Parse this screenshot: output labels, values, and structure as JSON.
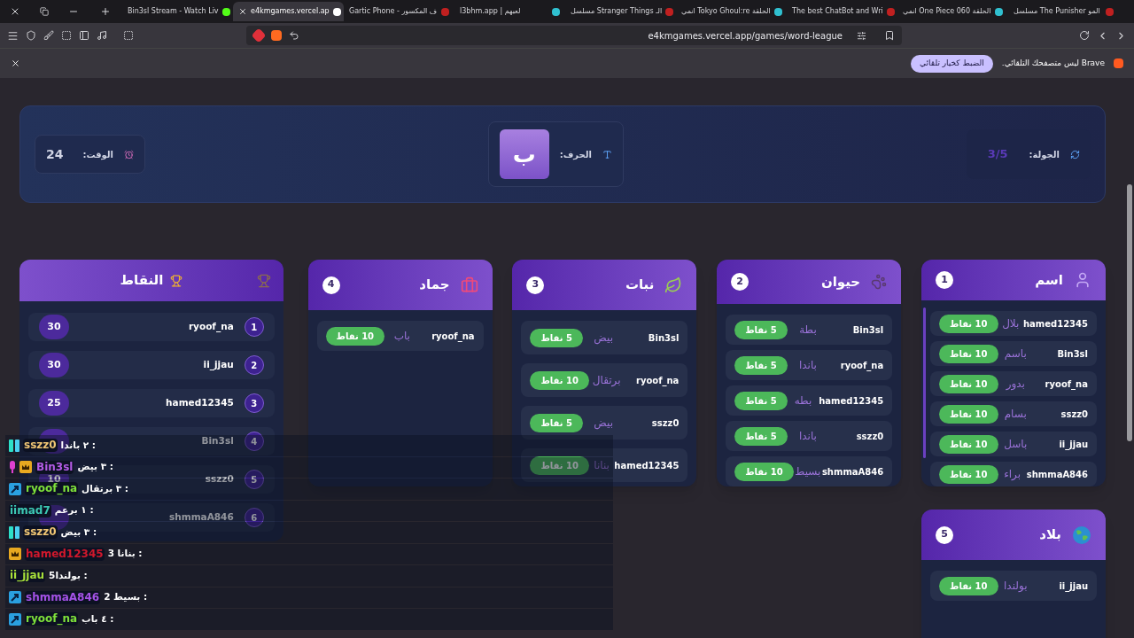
{
  "browser": {
    "tabs": [
      {
        "title": "مسلسل The Punisher المو",
        "selected": false
      },
      {
        "title": "انمي One Piece الحلقة 060",
        "selected": false
      },
      {
        "title": "The best ChatBot and Wri",
        "selected": false
      },
      {
        "title": "انمي Tokyo Ghoul:re الحلقة",
        "selected": false
      },
      {
        "title": "مسلسل Stranger Things الـ",
        "selected": false
      },
      {
        "title": "l3bhm.app | لعبهم",
        "selected": false
      },
      {
        "title": "Gartic Phone - ف المكسور",
        "selected": false
      },
      {
        "title": "e4kmgames.vercel.ap",
        "selected": true
      },
      {
        "title": "Bin3sl Stream - Watch Liv",
        "selected": false
      }
    ],
    "address": "e4kmgames.vercel.app/games/word-league",
    "notice": {
      "text": "Brave ليس متصفحك التلقائي.",
      "button": "الضبط كخيار تلقائي"
    }
  },
  "header": {
    "round": {
      "label": "الجولة:",
      "value": "3/5"
    },
    "letter": {
      "label": "الحرف:",
      "value": "ب"
    },
    "time": {
      "label": "الوقت:",
      "value": "24"
    }
  },
  "categories": [
    {
      "name": "اسم",
      "number": "1",
      "answers": [
        {
          "player": "hamed12345",
          "word": "بلال",
          "points": "10 نقاط"
        },
        {
          "player": "Bin3sl",
          "word": "باسم",
          "points": "10 نقاط"
        },
        {
          "player": "ryoof_na",
          "word": "بدور",
          "points": "10 نقاط"
        },
        {
          "player": "sszz0",
          "word": "بسام",
          "points": "10 نقاط"
        },
        {
          "player": "ii_jjau",
          "word": "باسل",
          "points": "10 نقاط"
        },
        {
          "player": "shmmaA846",
          "word": "براء",
          "points": "10 نقاط"
        }
      ]
    },
    {
      "name": "حيوان",
      "number": "2",
      "answers": [
        {
          "player": "Bin3sl",
          "word": "بطة",
          "points": "5 نقاط"
        },
        {
          "player": "ryoof_na",
          "word": "باندا",
          "points": "5 نقاط"
        },
        {
          "player": "hamed12345",
          "word": "بطه",
          "points": "5 نقاط"
        },
        {
          "player": "sszz0",
          "word": "باندا",
          "points": "5 نقاط"
        },
        {
          "player": "shmmaA846",
          "word": "بسيط",
          "points": "10 نقاط"
        }
      ]
    },
    {
      "name": "نبات",
      "number": "3",
      "answers": [
        {
          "player": "Bin3sl",
          "word": "بيض",
          "points": "5 نقاط"
        },
        {
          "player": "ryoof_na",
          "word": "برتقال",
          "points": "10 نقاط"
        },
        {
          "player": "sszz0",
          "word": "بيض",
          "points": "5 نقاط"
        },
        {
          "player": "hamed12345",
          "word": "بنانا",
          "points": "10 نقاط"
        }
      ]
    },
    {
      "name": "جماد",
      "number": "4",
      "answers": [
        {
          "player": "ryoof_na",
          "word": "باب",
          "points": "10 نقاط"
        }
      ]
    },
    {
      "name": "بلاد",
      "number": "5",
      "answers": [
        {
          "player": "ii_jjau",
          "word": "بولندا",
          "points": "10 نقاط"
        }
      ]
    }
  ],
  "scoreboard": {
    "title": "النقاط",
    "rows": [
      {
        "rank": "1",
        "player": "ryoof_na",
        "score": "30"
      },
      {
        "rank": "2",
        "player": "ii_jjau",
        "score": "30"
      },
      {
        "rank": "3",
        "player": "hamed12345",
        "score": "25"
      },
      {
        "rank": "4",
        "player": "Bin3sl"
      },
      {
        "rank": "5",
        "player": "sszz0",
        "score": "10"
      },
      {
        "rank": "6",
        "player": "shmmaA846"
      }
    ]
  },
  "chat": [
    {
      "user": "sszz0",
      "color": "#f0c674",
      "badges": [
        {
          "kind": "sub"
        }
      ],
      "message": ": ٢ باندا"
    },
    {
      "user": "Bin3sl",
      "color": "#b45ce6",
      "badges": [
        {
          "kind": "mic"
        },
        {
          "kind": "crown"
        }
      ],
      "message": ": ٣ بيض"
    },
    {
      "user": "ryoof_na",
      "color": "#7ee03a",
      "badges": [
        {
          "kind": "arrow"
        }
      ],
      "message": ": ٣ برتقال"
    },
    {
      "user": "iimad7",
      "color": "#3cc8b4",
      "message": ": ١ برعم"
    },
    {
      "user": "sszz0",
      "color": "#f0c674",
      "badges": [
        {
          "kind": "sub"
        }
      ],
      "message": ": ٣ بيض"
    },
    {
      "user": "hamed12345",
      "color": "#d0182c",
      "badges": [
        {
          "kind": "crown"
        }
      ],
      "message": ": بنانا 3"
    },
    {
      "user": "ii_jjau",
      "color": "#a8e03a",
      "message": ": بولندا5"
    },
    {
      "user": "shmmaA846",
      "color": "#a452e6",
      "badges": [
        {
          "kind": "arrow"
        }
      ],
      "message": ": بسيط 2"
    },
    {
      "user": "ryoof_na",
      "color": "#7ee03a",
      "badges": [
        {
          "kind": "arrow"
        }
      ],
      "message": ": ٤ باب"
    }
  ]
}
